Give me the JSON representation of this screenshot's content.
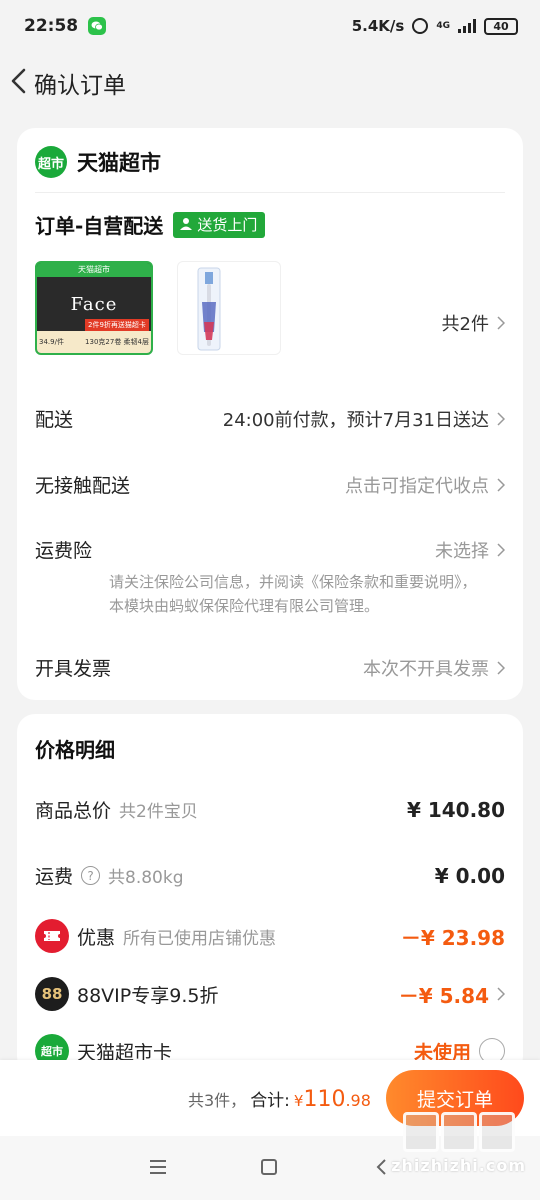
{
  "status_bar": {
    "time": "22:58",
    "net_speed": "5.4K/s",
    "network_type": "4G",
    "battery": "40"
  },
  "nav": {
    "title": "确认订单"
  },
  "store": {
    "badge": "超市",
    "name": "天猫超市"
  },
  "delivery": {
    "title": "订单-自营配送",
    "badge": "送货上门"
  },
  "products": {
    "count_label": "共2件",
    "item1": {
      "brand_bar": "天猫超市",
      "logo": "Face",
      "price_tag": "34.9/件",
      "promo": "2件9折再送猫超卡",
      "spec": "130克27卷 柔韧4层"
    }
  },
  "rows": {
    "shipping": {
      "label": "配送",
      "value": "24:00前付款，预计7月31日送达"
    },
    "contactless": {
      "label": "无接触配送",
      "value": "点击可指定代收点"
    },
    "insurance": {
      "label": "运费险",
      "value": "未选择",
      "note": "请关注保险公司信息，并阅读《保险条款和重要说明》，本模块由蚂蚁保保险代理有限公司管理。"
    },
    "invoice": {
      "label": "开具发票",
      "value": "本次不开具发票"
    }
  },
  "price": {
    "title": "价格明细",
    "goods_total": {
      "label": "商品总价",
      "sub": "共2件宝贝",
      "amount": "¥ 140.80"
    },
    "freight": {
      "label": "运费",
      "sub": "共8.80kg",
      "amount": "¥ 0.00"
    },
    "discount": {
      "label": "优惠",
      "sub": "所有已使用店铺优惠",
      "amount": "－¥ 23.98"
    },
    "vip": {
      "icon": "88",
      "label": "88VIP专享9.5折",
      "amount": "－¥ 5.84"
    },
    "supermarket_card": {
      "icon": "超市",
      "label": "天猫超市卡",
      "status": "未使用"
    }
  },
  "bottom": {
    "count": "共3件，",
    "total_label": "合计:",
    "currency": "¥",
    "total_int": "110",
    "total_dec": ".98",
    "submit": "提交订单"
  },
  "watermark": {
    "text": "zhizhizhi.com"
  },
  "colors": {
    "accent_orange": "#f45b10",
    "tmall_green": "#1aa93a",
    "coupon_red": "#e31d30"
  }
}
